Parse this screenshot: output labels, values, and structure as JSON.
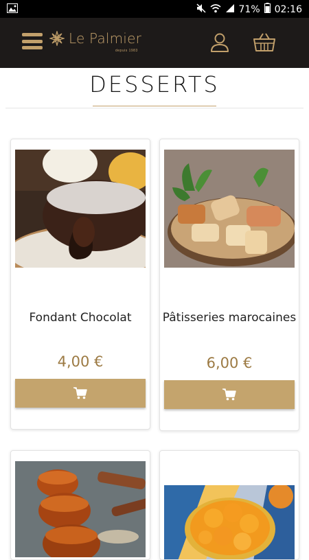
{
  "status_bar": {
    "battery": "71%",
    "time": "02:16"
  },
  "header": {
    "brand": "Le Palmier",
    "brand_sub": "depuis 1983"
  },
  "page": {
    "title": "DESSERTS"
  },
  "products": [
    {
      "name": "Fondant Chocolat",
      "price": "4,00 €",
      "image": "chocolate-fondant-image"
    },
    {
      "name": "Pâtisseries marocaines",
      "price": "6,00 €",
      "image": "moroccan-pastries-image"
    },
    {
      "name": "",
      "price": "",
      "image": "caramelized-apple-tartlets-image"
    },
    {
      "name": "",
      "price": "",
      "image": "orange-salad-image"
    }
  ],
  "colors": {
    "accent": "#c4a46d",
    "header_bg": "#1d1a19",
    "price": "#9c7a43"
  }
}
